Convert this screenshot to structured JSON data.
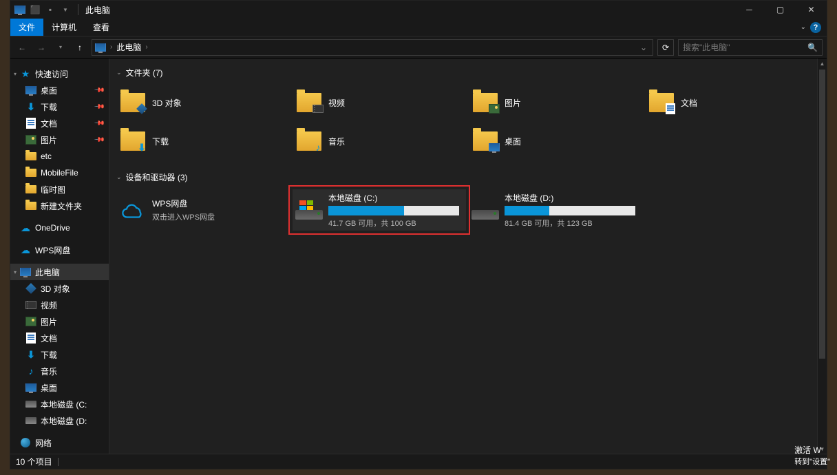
{
  "titlebar": {
    "title": "此电脑"
  },
  "ribbon": {
    "file": "文件",
    "tabs": [
      "计算机",
      "查看"
    ]
  },
  "addr": {
    "location": "此电脑",
    "separator": "›"
  },
  "search": {
    "placeholder": "搜索\"此电脑\""
  },
  "sidebar": {
    "quickAccess": "快速访问",
    "qa_items": [
      {
        "label": "桌面",
        "icon": "monitor",
        "pinned": true
      },
      {
        "label": "下载",
        "icon": "download",
        "pinned": true
      },
      {
        "label": "文档",
        "icon": "doc",
        "pinned": true
      },
      {
        "label": "图片",
        "icon": "pic",
        "pinned": true
      },
      {
        "label": "etc",
        "icon": "folder",
        "pinned": false
      },
      {
        "label": "MobileFile",
        "icon": "folder",
        "pinned": false
      },
      {
        "label": "临时图",
        "icon": "folder",
        "pinned": false
      },
      {
        "label": "新建文件夹",
        "icon": "folder",
        "pinned": false
      }
    ],
    "onedrive": "OneDrive",
    "wps": "WPS网盘",
    "thispc": "此电脑",
    "pc_items": [
      {
        "label": "3D 对象",
        "icon": "3d"
      },
      {
        "label": "视频",
        "icon": "vid"
      },
      {
        "label": "图片",
        "icon": "pic"
      },
      {
        "label": "文档",
        "icon": "doc"
      },
      {
        "label": "下载",
        "icon": "download"
      },
      {
        "label": "音乐",
        "icon": "music"
      },
      {
        "label": "桌面",
        "icon": "monitor"
      },
      {
        "label": "本地磁盘 (C:",
        "icon": "disk"
      },
      {
        "label": "本地磁盘 (D:",
        "icon": "disk"
      }
    ],
    "network": "网络"
  },
  "content": {
    "folders_hdr": "文件夹 (7)",
    "folders": [
      {
        "label": "3D 对象",
        "overlay": "3d"
      },
      {
        "label": "视频",
        "overlay": "vid"
      },
      {
        "label": "图片",
        "overlay": "pic"
      },
      {
        "label": "文档",
        "overlay": "doc"
      },
      {
        "label": "下载",
        "overlay": "download"
      },
      {
        "label": "音乐",
        "overlay": "music"
      },
      {
        "label": "桌面",
        "overlay": "monitor"
      }
    ],
    "drives_hdr": "设备和驱动器 (3)",
    "drives": [
      {
        "type": "cloud",
        "name": "WPS网盘",
        "sub": "双击进入WPS网盘"
      },
      {
        "type": "disk",
        "name": "本地磁盘 (C:)",
        "sub": "41.7 GB 可用，共 100 GB",
        "pct": 58,
        "highlighted": true,
        "windows": true
      },
      {
        "type": "disk",
        "name": "本地磁盘 (D:)",
        "sub": "81.4 GB 可用，共 123 GB",
        "pct": 34,
        "highlighted": false,
        "windows": false
      }
    ]
  },
  "status": {
    "items": "10 个项目"
  },
  "watermark": {
    "line1": "激活 W",
    "line2": "转到\"设置\""
  }
}
